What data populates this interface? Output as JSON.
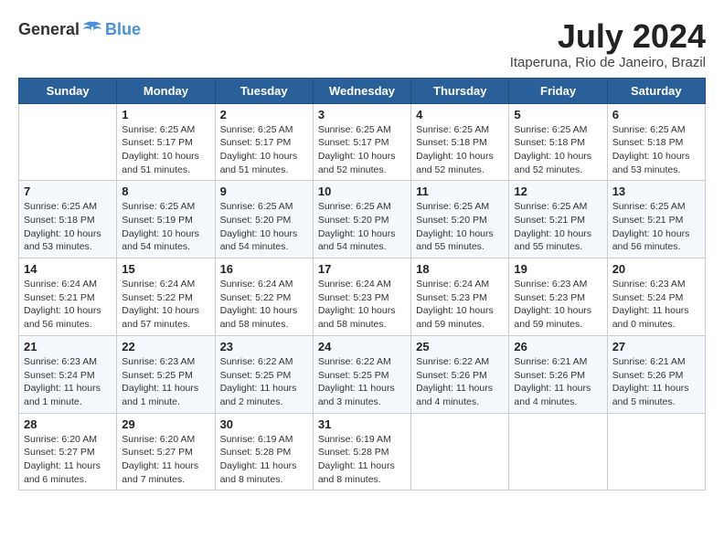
{
  "header": {
    "logo_general": "General",
    "logo_blue": "Blue",
    "month_year": "July 2024",
    "location": "Itaperuna, Rio de Janeiro, Brazil"
  },
  "days_of_week": [
    "Sunday",
    "Monday",
    "Tuesday",
    "Wednesday",
    "Thursday",
    "Friday",
    "Saturday"
  ],
  "weeks": [
    [
      {
        "day": "",
        "info": ""
      },
      {
        "day": "1",
        "info": "Sunrise: 6:25 AM\nSunset: 5:17 PM\nDaylight: 10 hours\nand 51 minutes."
      },
      {
        "day": "2",
        "info": "Sunrise: 6:25 AM\nSunset: 5:17 PM\nDaylight: 10 hours\nand 51 minutes."
      },
      {
        "day": "3",
        "info": "Sunrise: 6:25 AM\nSunset: 5:17 PM\nDaylight: 10 hours\nand 52 minutes."
      },
      {
        "day": "4",
        "info": "Sunrise: 6:25 AM\nSunset: 5:18 PM\nDaylight: 10 hours\nand 52 minutes."
      },
      {
        "day": "5",
        "info": "Sunrise: 6:25 AM\nSunset: 5:18 PM\nDaylight: 10 hours\nand 52 minutes."
      },
      {
        "day": "6",
        "info": "Sunrise: 6:25 AM\nSunset: 5:18 PM\nDaylight: 10 hours\nand 53 minutes."
      }
    ],
    [
      {
        "day": "7",
        "info": "Sunrise: 6:25 AM\nSunset: 5:18 PM\nDaylight: 10 hours\nand 53 minutes."
      },
      {
        "day": "8",
        "info": "Sunrise: 6:25 AM\nSunset: 5:19 PM\nDaylight: 10 hours\nand 54 minutes."
      },
      {
        "day": "9",
        "info": "Sunrise: 6:25 AM\nSunset: 5:20 PM\nDaylight: 10 hours\nand 54 minutes."
      },
      {
        "day": "10",
        "info": "Sunrise: 6:25 AM\nSunset: 5:20 PM\nDaylight: 10 hours\nand 54 minutes."
      },
      {
        "day": "11",
        "info": "Sunrise: 6:25 AM\nSunset: 5:20 PM\nDaylight: 10 hours\nand 55 minutes."
      },
      {
        "day": "12",
        "info": "Sunrise: 6:25 AM\nSunset: 5:21 PM\nDaylight: 10 hours\nand 55 minutes."
      },
      {
        "day": "13",
        "info": "Sunrise: 6:25 AM\nSunset: 5:21 PM\nDaylight: 10 hours\nand 56 minutes."
      }
    ],
    [
      {
        "day": "14",
        "info": "Sunrise: 6:24 AM\nSunset: 5:21 PM\nDaylight: 10 hours\nand 56 minutes."
      },
      {
        "day": "15",
        "info": "Sunrise: 6:24 AM\nSunset: 5:22 PM\nDaylight: 10 hours\nand 57 minutes."
      },
      {
        "day": "16",
        "info": "Sunrise: 6:24 AM\nSunset: 5:22 PM\nDaylight: 10 hours\nand 58 minutes."
      },
      {
        "day": "17",
        "info": "Sunrise: 6:24 AM\nSunset: 5:23 PM\nDaylight: 10 hours\nand 58 minutes."
      },
      {
        "day": "18",
        "info": "Sunrise: 6:24 AM\nSunset: 5:23 PM\nDaylight: 10 hours\nand 59 minutes."
      },
      {
        "day": "19",
        "info": "Sunrise: 6:23 AM\nSunset: 5:23 PM\nDaylight: 10 hours\nand 59 minutes."
      },
      {
        "day": "20",
        "info": "Sunrise: 6:23 AM\nSunset: 5:24 PM\nDaylight: 11 hours\nand 0 minutes."
      }
    ],
    [
      {
        "day": "21",
        "info": "Sunrise: 6:23 AM\nSunset: 5:24 PM\nDaylight: 11 hours\nand 1 minute."
      },
      {
        "day": "22",
        "info": "Sunrise: 6:23 AM\nSunset: 5:25 PM\nDaylight: 11 hours\nand 1 minute."
      },
      {
        "day": "23",
        "info": "Sunrise: 6:22 AM\nSunset: 5:25 PM\nDaylight: 11 hours\nand 2 minutes."
      },
      {
        "day": "24",
        "info": "Sunrise: 6:22 AM\nSunset: 5:25 PM\nDaylight: 11 hours\nand 3 minutes."
      },
      {
        "day": "25",
        "info": "Sunrise: 6:22 AM\nSunset: 5:26 PM\nDaylight: 11 hours\nand 4 minutes."
      },
      {
        "day": "26",
        "info": "Sunrise: 6:21 AM\nSunset: 5:26 PM\nDaylight: 11 hours\nand 4 minutes."
      },
      {
        "day": "27",
        "info": "Sunrise: 6:21 AM\nSunset: 5:26 PM\nDaylight: 11 hours\nand 5 minutes."
      }
    ],
    [
      {
        "day": "28",
        "info": "Sunrise: 6:20 AM\nSunset: 5:27 PM\nDaylight: 11 hours\nand 6 minutes."
      },
      {
        "day": "29",
        "info": "Sunrise: 6:20 AM\nSunset: 5:27 PM\nDaylight: 11 hours\nand 7 minutes."
      },
      {
        "day": "30",
        "info": "Sunrise: 6:19 AM\nSunset: 5:28 PM\nDaylight: 11 hours\nand 8 minutes."
      },
      {
        "day": "31",
        "info": "Sunrise: 6:19 AM\nSunset: 5:28 PM\nDaylight: 11 hours\nand 8 minutes."
      },
      {
        "day": "",
        "info": ""
      },
      {
        "day": "",
        "info": ""
      },
      {
        "day": "",
        "info": ""
      }
    ]
  ]
}
